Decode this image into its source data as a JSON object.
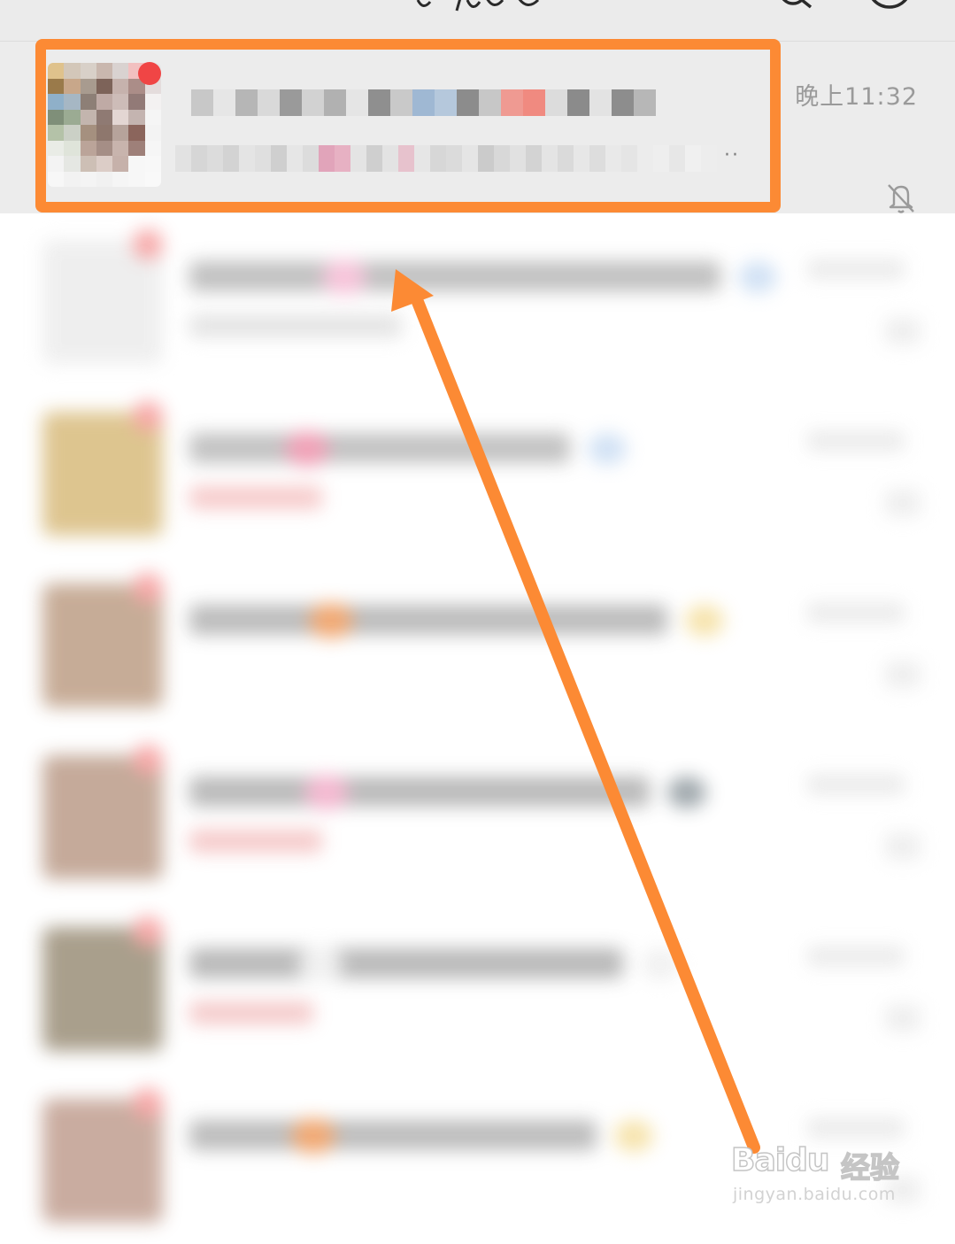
{
  "header": {
    "search_icon": "search-icon",
    "add_icon": "add-circle-icon"
  },
  "chats": [
    {
      "timestamp": "晚上11:32",
      "muted": true,
      "unread": true,
      "name_colors": [
        "#c8c8c8",
        "#e6e6e6",
        "#b6b6b6",
        "#d9d9d9",
        "#9a9a9a",
        "#d2d2d2",
        "#b1b1b1",
        "#e5e5e5",
        "#8f8f8f",
        "#c9c9c9",
        "#9fb8d3",
        "#b5c8dc",
        "#8c8c8c",
        "#c7c7c7",
        "#ef9a92",
        "#f08a80",
        "#dcdcdc",
        "#8b8b8b",
        "#e3e3e3",
        "#8d8d8d",
        "#b7b7b7"
      ],
      "preview_colors": [
        "#e2e2e2",
        "#d6d6d6",
        "#dcdcdc",
        "#d3d3d3",
        "#e4e4e4",
        "#dfdfdf",
        "#cfcfcf",
        "#e6e6e6",
        "#dcdcdc",
        "#e1a4ba",
        "#e7b1c3",
        "#e4e4e4",
        "#cfcfcf",
        "#e3e3e3",
        "#e7c2cd",
        "#e6e6e6",
        "#d7d7d7",
        "#dbdbdb",
        "#e5e5e5",
        "#cbcbcb",
        "#d8d8d8",
        "#e1e1e1",
        "#d3d3d3",
        "#e4e4e4",
        "#dadada",
        "#e7e7e7",
        "#dddddd",
        "#e9e9e9",
        "#e5e5e5",
        "#ececec",
        "#eeeeee",
        "#e7e7e7",
        "#f0f0f0",
        "#ededed"
      ],
      "avatar_colors": [
        "#dfc28c",
        "#d3c7b9",
        "#d8d0c8",
        "#c9b7ae",
        "#d9d2d0",
        "#f2c0c0",
        "#e6e6e6",
        "#9a7a4a",
        "#c8a78a",
        "#a89b8f",
        "#7d6359",
        "#c6b2ad",
        "#ab8d88",
        "#e4dcdc",
        "#8fb0c9",
        "#a6b7c4",
        "#8d7f76",
        "#bfaaa5",
        "#cdbcb8",
        "#927a77",
        "#f3f1f1",
        "#7f8f79",
        "#9bab93",
        "#c3b5ae",
        "#8f7a73",
        "#e3d6d3",
        "#c4b4b0",
        "#f5f5f5",
        "#b4c2a8",
        "#cbd0c6",
        "#a5907f",
        "#8e776d",
        "#b6a39b",
        "#8b655c",
        "#f3f3f3",
        "#e9ece6",
        "#dfe4da",
        "#bba499",
        "#a58e86",
        "#c8b4ad",
        "#9e8079",
        "#f6f6f6",
        "#f3f3f3",
        "#e5e7e3",
        "#cdbfb5",
        "#dccdc7",
        "#c6b1aa",
        "#f7f7f7",
        "#f8f8f8",
        "#f7f7f7",
        "#f2f2f2",
        "#f4f4f4",
        "#f1f1f1",
        "#f5f5f5",
        "#f7f7f7",
        "#f9f9f9"
      ]
    },
    {
      "avatar_color": "#eeeeee",
      "name_width": 600,
      "name_color": "#bdbdbd",
      "accent": "#f6c1d8",
      "accent2": "#cfe0f4",
      "preview_width": 240,
      "preview_color": "#e2e2e2"
    },
    {
      "avatar_color": "#dcc28a",
      "name_width": 430,
      "name_color": "#bfbfbf",
      "accent": "#ef9cb3",
      "accent2": "#cfe0f4",
      "preview_width": 150,
      "preview_color": "#f6c8c8"
    },
    {
      "avatar_color": "#c4a892",
      "name_width": 540,
      "name_color": "#b8b8b8",
      "accent": "#f0a46c",
      "accent2": "#f6e2a8",
      "preview_width": 0,
      "preview_color": "#e6e6e6"
    },
    {
      "avatar_color": "#c2a695",
      "name_width": 520,
      "name_color": "#b6b6b6",
      "accent": "#f3b4cd",
      "accent2": "#9aa3a8",
      "preview_width": 150,
      "preview_color": "#f5c7c7"
    },
    {
      "avatar_color": "#a59a86",
      "name_width": 490,
      "name_color": "#b5b5b5",
      "accent": "#f0f0f0",
      "accent2": "#f0f0f0",
      "preview_width": 140,
      "preview_color": "#f4c8c8"
    },
    {
      "avatar_color": "#c7a89b",
      "name_width": 460,
      "name_color": "#b9b9b9",
      "accent": "#f0a46c",
      "accent2": "#f6e2a8",
      "preview_width": 0,
      "preview_color": "#e6e6e6"
    }
  ],
  "annotation": {
    "color": "#fc8a34"
  },
  "watermark": {
    "logo": "Baidu",
    "cn": "经验",
    "url": "jingyan.baidu.com"
  }
}
